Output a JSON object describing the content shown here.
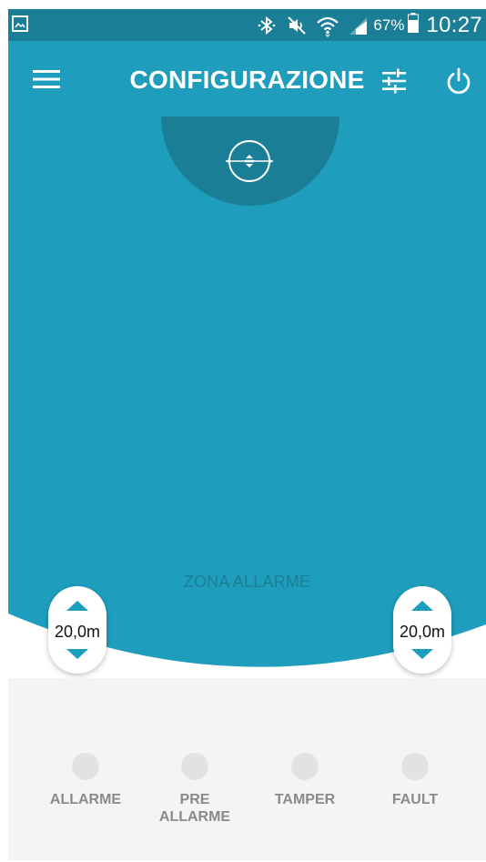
{
  "status_bar": {
    "battery_percent": "67%",
    "time": "10:27",
    "icons": [
      "gallery-thumbnail-icon",
      "bluetooth-icon",
      "mute-icon",
      "wifi-icon",
      "signal-icon",
      "battery-icon"
    ]
  },
  "toolbar": {
    "title": "CONFIGURAZIONE",
    "icons": [
      "menu-icon",
      "tune-icon",
      "power-icon"
    ]
  },
  "detection": {
    "zone_label": "ZONA ALLARME",
    "left_range": "20,0m",
    "right_range": "20,0m"
  },
  "indicators": [
    {
      "label": "ALLARME"
    },
    {
      "label": "PRE\nALLARME"
    },
    {
      "label": "TAMPER"
    },
    {
      "label": "FAULT"
    }
  ],
  "colors": {
    "primary": "#1f9dbd",
    "primary_dark": "#1a7f96",
    "panel_background": "#f4f4f4",
    "indicator_off": "#e2e2e2",
    "indicator_text": "#8a8a8a"
  }
}
